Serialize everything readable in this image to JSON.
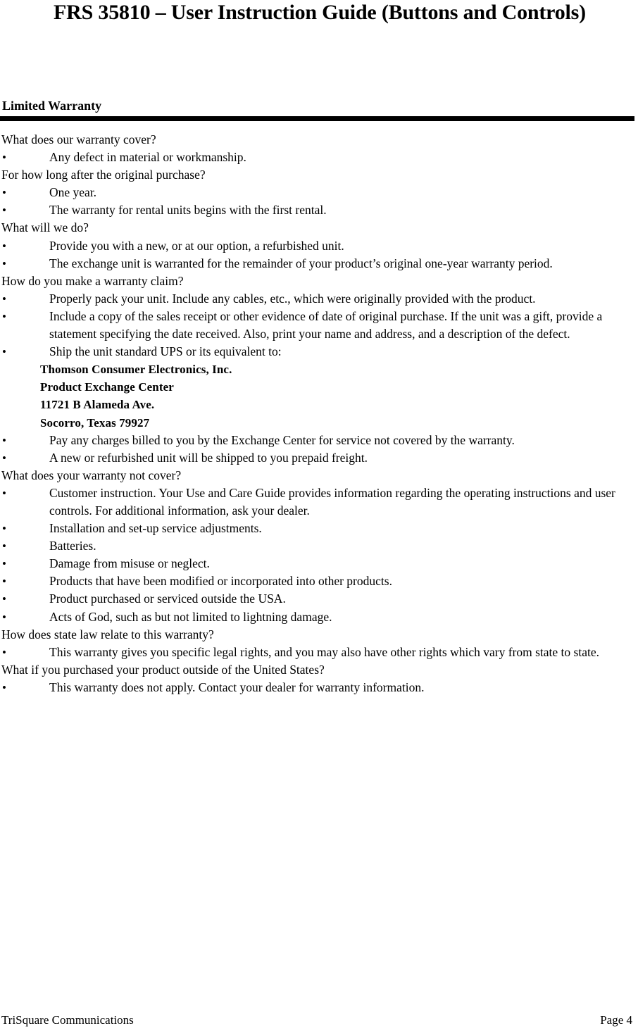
{
  "document": {
    "title": "FRS 35810 – User Instruction Guide (Buttons and Controls)",
    "section_heading": "Limited Warranty",
    "bullet_glyph": "•"
  },
  "content": {
    "q1": "What does our warranty cover?",
    "b1": "Any defect in material or workmanship.",
    "q2": "For how long after the original purchase?",
    "b2": "One year.",
    "b3": "The warranty for rental units begins with the first rental.",
    "q3": "What will we do?",
    "b4": "Provide you with a new, or at our option, a refurbished unit.",
    "b5": "The exchange unit is warranted for the remainder of your product’s original one-year warranty period.",
    "q4": "How do you make a warranty claim?",
    "b6": "Properly pack your unit. Include any cables, etc., which were originally provided with the product.",
    "b7": "Include a copy of the sales receipt or other evidence of date of original purchase.  If the unit was a gift, provide a statement specifying the date received.  Also, print your name and address, and a description of the defect.",
    "b8": "Ship the unit standard UPS or its equivalent to:",
    "addr1": "Thomson Consumer Electronics, Inc.",
    "addr2": "Product Exchange Center",
    "addr3": "11721 B Alameda Ave.",
    "addr4": "Socorro, Texas 79927",
    "b9": "Pay any charges billed to you by the Exchange Center for service not covered by the warranty.",
    "b10": "A new or refurbished unit will be shipped to you prepaid freight.",
    "q5": "What does your warranty not cover?",
    "b11": "Customer instruction.  Your Use and Care Guide provides information regarding the operating instructions and user controls.  For additional information, ask your dealer.",
    "b12": "Installation and set-up service adjustments.",
    "b13": "Batteries.",
    "b14": "Damage from misuse or neglect.",
    "b15": "Products that have been modified or incorporated into other products.",
    "b16": "Product purchased or serviced outside the USA.",
    "b17": "Acts of God, such as but not limited to lightning damage.",
    "q6": "How does state law relate to this warranty?",
    "b18": "This warranty gives you specific legal rights, and you may also have other rights which vary from state to state.",
    "q7": "What if you purchased your product outside of the United States?",
    "b19": "This warranty does not apply.  Contact your dealer for warranty information."
  },
  "footer": {
    "left": "TriSquare Communications",
    "right": "Page 4"
  }
}
